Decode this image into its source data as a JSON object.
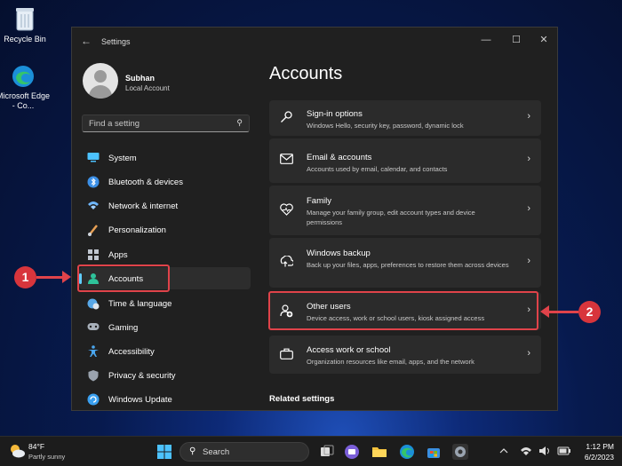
{
  "desktop": {
    "icons": [
      {
        "label": "Recycle Bin",
        "icon": "recycle-bin-icon"
      },
      {
        "label": "Microsoft Edge - Co...",
        "icon": "edge-icon"
      }
    ]
  },
  "window": {
    "title": "Settings",
    "controls": {
      "minimize": "—",
      "maximize": "☐",
      "close": "✕"
    }
  },
  "user": {
    "name": "Subhan",
    "account_type": "Local Account"
  },
  "search": {
    "placeholder": "Find a setting"
  },
  "sidebar": {
    "items": [
      {
        "label": "System",
        "icon": "monitor-icon",
        "color": "#4cc2ff"
      },
      {
        "label": "Bluetooth & devices",
        "icon": "bluetooth-icon",
        "color": "#3b8fe6"
      },
      {
        "label": "Network & internet",
        "icon": "wifi-icon",
        "color": "#6fb7ff"
      },
      {
        "label": "Personalization",
        "icon": "brush-icon",
        "color": "#e8a055"
      },
      {
        "label": "Apps",
        "icon": "apps-icon",
        "color": "#c0c6d0"
      },
      {
        "label": "Accounts",
        "icon": "person-icon",
        "color": "#2ec29a",
        "active": true
      },
      {
        "label": "Time & language",
        "icon": "globe-clock-icon",
        "color": "#58a8e8"
      },
      {
        "label": "Gaming",
        "icon": "gamepad-icon",
        "color": "#a8b0ba"
      },
      {
        "label": "Accessibility",
        "icon": "accessibility-icon",
        "color": "#4aa6ee"
      },
      {
        "label": "Privacy & security",
        "icon": "shield-icon",
        "color": "#9aa3ae"
      },
      {
        "label": "Windows Update",
        "icon": "update-icon",
        "color": "#3aa0f0"
      }
    ]
  },
  "main": {
    "title": "Accounts",
    "cards": [
      {
        "title": "Sign-in options",
        "description": "Windows Hello, security key, password, dynamic lock",
        "icon": "key-icon"
      },
      {
        "title": "Email & accounts",
        "description": "Accounts used by email, calendar, and contacts",
        "icon": "mail-icon"
      },
      {
        "title": "Family",
        "description": "Manage your family group, edit account types and device permissions",
        "icon": "family-heart-icon"
      },
      {
        "title": "Windows backup",
        "description": "Back up your files, apps, preferences to restore them across devices",
        "icon": "backup-icon"
      },
      {
        "title": "Other users",
        "description": "Device access, work or school users, kiosk assigned access",
        "icon": "add-person-icon"
      },
      {
        "title": "Access work or school",
        "description": "Organization resources like email, apps, and the network",
        "icon": "briefcase-icon"
      }
    ],
    "related_heading": "Related settings"
  },
  "annotations": {
    "step1": "1",
    "step2": "2",
    "color": "#e0434a"
  },
  "taskbar": {
    "weather_temp": "84°F",
    "weather_desc": "Partly sunny",
    "search_label": "Search",
    "time": "1:12 PM",
    "date": "6/2/2023"
  }
}
